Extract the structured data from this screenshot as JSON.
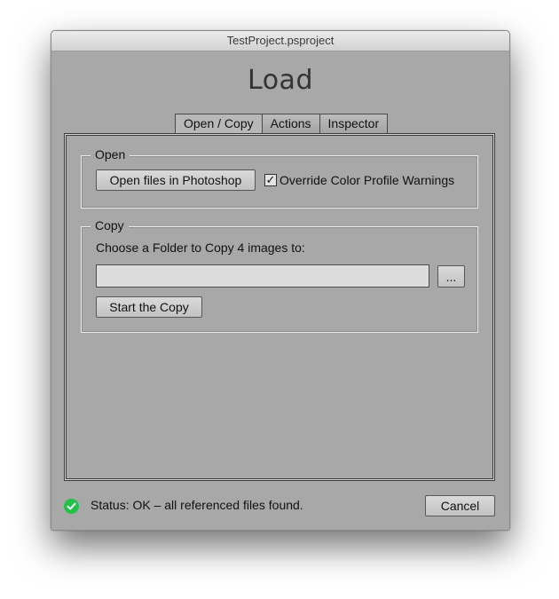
{
  "window": {
    "title": "TestProject.psproject"
  },
  "dialog": {
    "heading": "Load"
  },
  "tabs": [
    {
      "label": "Open / Copy",
      "active": true
    },
    {
      "label": "Actions",
      "active": false
    },
    {
      "label": "Inspector",
      "active": false
    }
  ],
  "open_group": {
    "legend": "Open",
    "open_button_label": "Open files in Photoshop",
    "override_checkbox_label": "Override Color Profile Warnings",
    "override_checked": true
  },
  "copy_group": {
    "legend": "Copy",
    "instruction": "Choose a Folder to Copy 4 images to:",
    "folder_value": "",
    "browse_button_label": "...",
    "start_button_label": "Start the Copy"
  },
  "status": {
    "icon": "check-circle-icon",
    "icon_color": "#22c24a",
    "text": "Status: OK – all referenced files found."
  },
  "footer": {
    "cancel_label": "Cancel"
  }
}
